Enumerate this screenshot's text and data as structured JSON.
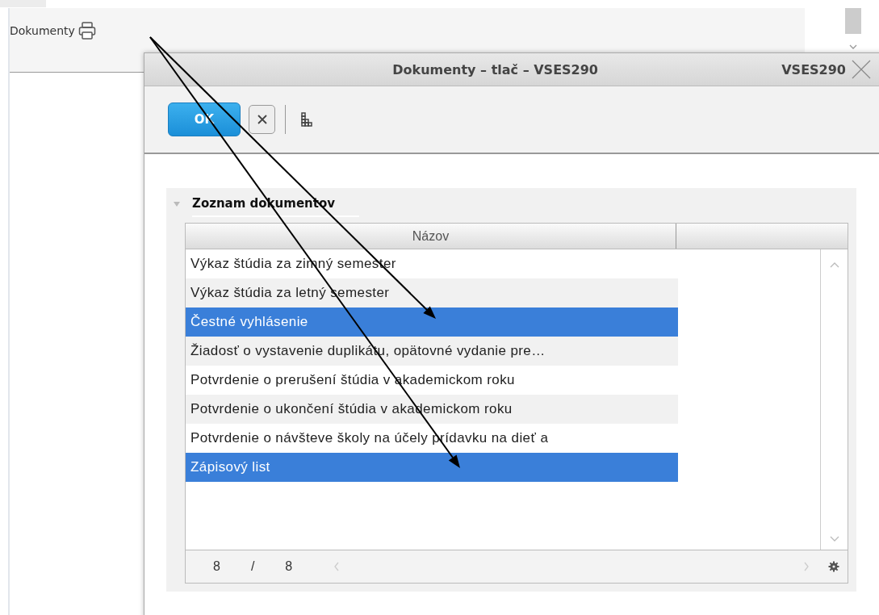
{
  "page": {
    "title": "Dokumenty"
  },
  "dialog": {
    "title": "Dokumenty – tlač – VSES290",
    "code": "VSES290",
    "ok_button": "OK",
    "section": {
      "title": "Zoznam dokumentov",
      "expanded": true,
      "table": {
        "columns": [
          "Názov"
        ],
        "rows": [
          {
            "name": "Výkaz štúdia za zimný semester",
            "selected": false
          },
          {
            "name": "Výkaz štúdia za letný semester",
            "selected": false
          },
          {
            "name": "Čestné vyhlásenie",
            "selected": true
          },
          {
            "name": "Žiadosť o vystavenie duplikátu, opätovné vydanie pre…",
            "selected": false
          },
          {
            "name": "Potvrdenie o prerušení štúdia v akademickom roku",
            "selected": false
          },
          {
            "name": "Potvrdenie o ukončení štúdia v akademickom roku",
            "selected": false
          },
          {
            "name": "Potvrdenie o návšteve školy na účely prídavku na dieť a",
            "selected": false
          },
          {
            "name": "Zápisový list",
            "selected": true
          }
        ],
        "pager": {
          "current": "8",
          "separator": "/",
          "total": "8"
        }
      }
    }
  }
}
